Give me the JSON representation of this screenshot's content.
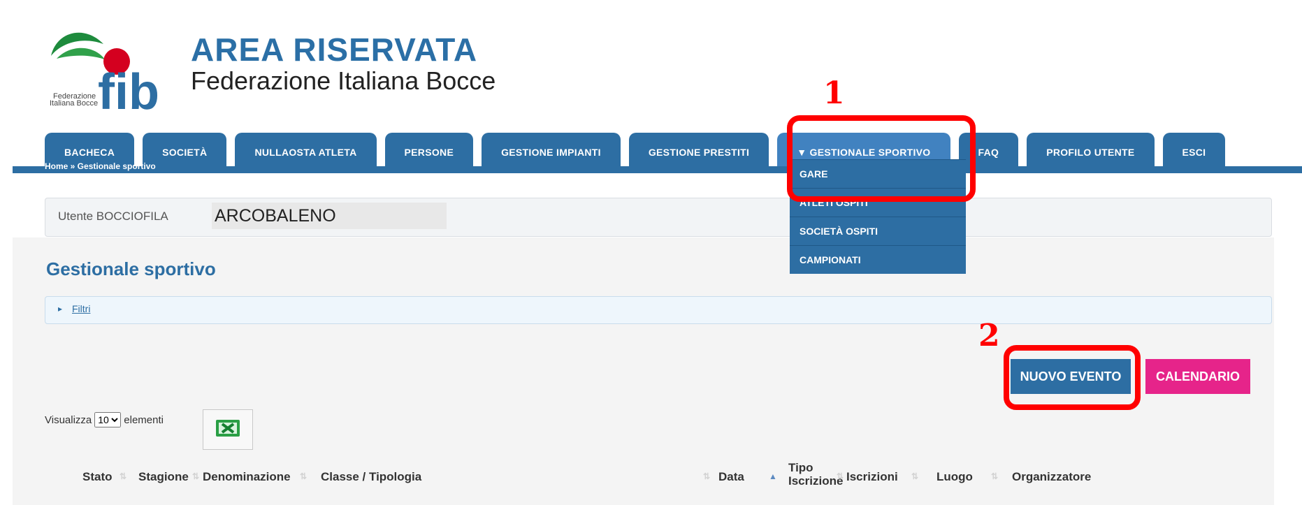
{
  "brand": {
    "title": "AREA RISERVATA",
    "subtitle": "Federazione Italiana Bocce",
    "logo_small_text": "Federazione Italiana Bocce",
    "logo_letters": "fib"
  },
  "nav": [
    {
      "label": "BACHECA"
    },
    {
      "label": "SOCIETÀ"
    },
    {
      "label": "NULLAOSTA ATLETA"
    },
    {
      "label": "PERSONE"
    },
    {
      "label": "GESTIONE IMPIANTI"
    },
    {
      "label": "GESTIONE PRESTITI"
    },
    {
      "label": "▼ GESTIONALE SPORTIVO"
    },
    {
      "label": "FAQ"
    },
    {
      "label": "PROFILO UTENTE"
    },
    {
      "label": "ESCI"
    }
  ],
  "breadcrumb": "Home » Gestionale sportivo",
  "user": {
    "label": "Utente BOCCIOFILA",
    "value": "ARCOBALENO"
  },
  "section_title": "Gestionale sportivo",
  "filters_label": "Filtri",
  "buttons": {
    "new_event": "NUOVO EVENTO",
    "calendar": "CALENDARIO"
  },
  "entries": {
    "prefix": "Visualizza",
    "selected": "10",
    "suffix": "elementi"
  },
  "columns": [
    "Stato",
    "Stagione",
    "Denominazione",
    "Classe / Tipologia",
    "Data",
    "Tipo",
    "Iscrizione",
    "Iscrizioni",
    "Luogo",
    "Organizzatore"
  ],
  "dropdown": [
    "GARE",
    "ATLETI OSPITI",
    "SOCIETÀ OSPITI",
    "CAMPIONATI"
  ],
  "annotations": {
    "one": "1",
    "two": "2"
  },
  "colors": {
    "primary": "#2d6ea3",
    "accent": "#e6248a",
    "highlight": "#ff0000"
  }
}
